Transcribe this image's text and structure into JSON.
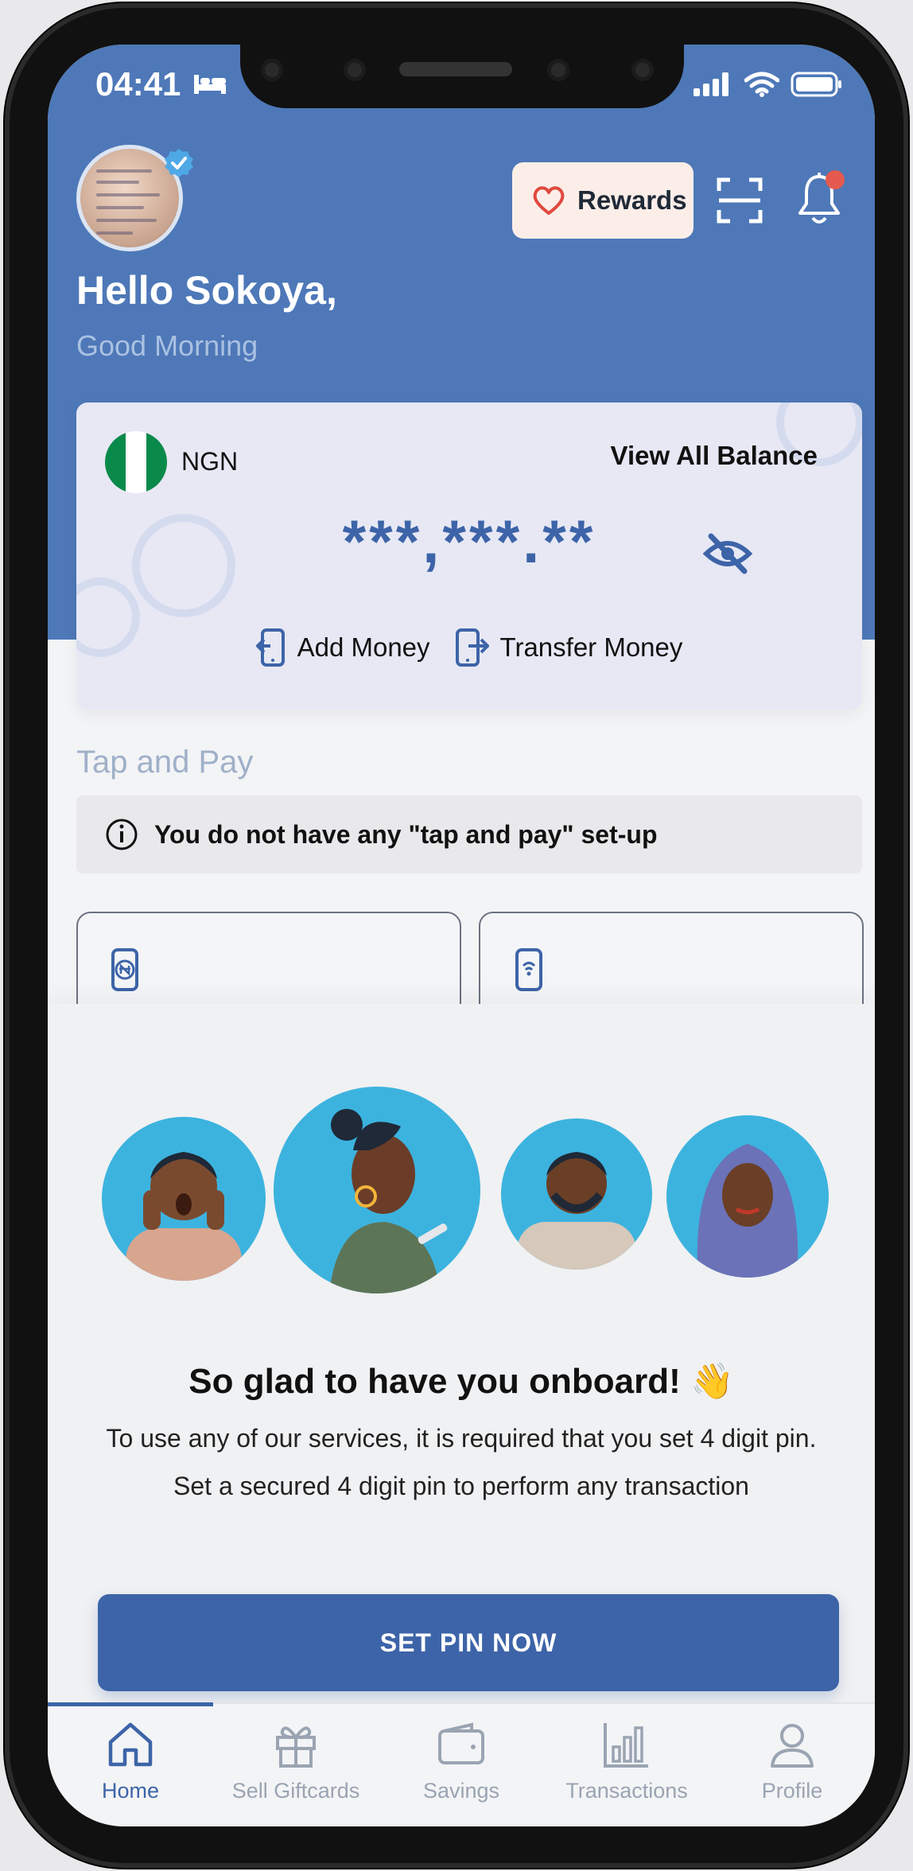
{
  "status_bar": {
    "time": "04:41"
  },
  "header": {
    "greeting": "Hello Sokoya,",
    "subgreeting": "Good Morning",
    "rewards_label": "Rewards"
  },
  "balance": {
    "currency": "NGN",
    "view_all_label": "View All Balance",
    "masked_amount": "***,***.**",
    "add_money_label": "Add Money",
    "transfer_money_label": "Transfer Money"
  },
  "tap_and_pay": {
    "title": "Tap and Pay",
    "notice": "You do not have any \"tap and pay\" set-up"
  },
  "onboarding": {
    "title": "So glad to have you onboard! 👋",
    "line1": "To use any of our services, it is required that you set 4 digit pin.",
    "line2": "Set a secured 4 digit pin to perform any transaction",
    "button_label": "SET PIN NOW"
  },
  "bottom_nav": {
    "items": [
      {
        "label": "Home",
        "icon": "home-icon",
        "active": true
      },
      {
        "label": "Sell Giftcards",
        "icon": "gift-icon"
      },
      {
        "label": "Savings",
        "icon": "wallet-icon"
      },
      {
        "label": "Transactions",
        "icon": "bar-chart-icon"
      },
      {
        "label": "Profile",
        "icon": "user-icon"
      }
    ]
  },
  "colors": {
    "primary": "#3d64a8",
    "header_bg": "#4e78b8",
    "notification_dot": "#e55a4e",
    "rewards_bg": "#fbeee8"
  }
}
